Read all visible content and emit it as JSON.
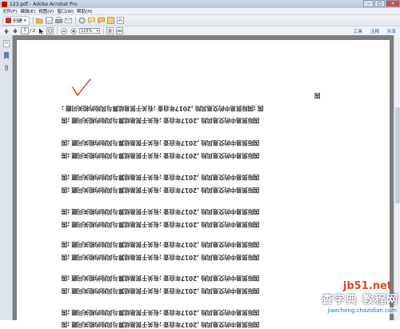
{
  "window": {
    "title": "123.pdf - Adobe Acrobat Pro",
    "controls": [
      "–",
      "□",
      "×"
    ]
  },
  "menubar": [
    "文件(F)",
    "编辑(E)",
    "视图(V)",
    "窗口(W)",
    "帮助(H)"
  ],
  "toolbar": {
    "create_label": "创建",
    "create_caret": "▾",
    "icons": [
      "open-icon",
      "save-icon",
      "print-icon",
      "email-icon",
      "settings-icon",
      "comment-icon",
      "highlight-icon",
      "share-icon",
      "sign-icon"
    ]
  },
  "navbar": {
    "current_page": "1",
    "total_pages": "/ 2",
    "zoom": "115%",
    "caret": "▾",
    "panels": [
      "工具",
      "注释",
      "共享"
    ]
  },
  "document": {
    "lines": [
      "国 ;国际贸易中的交易风险 ,2017年自查 ;有关于贸易结算与风险的相关问题 ;",
      "国际贸易中的交易风险 ,2017年自查 ;有关于贸易结算与风险的相关问题 ;国",
      "国际贸易中的交易风险 ,2017年自查 ;有关于贸易结算与风险的相关问题 ;国",
      "国际贸易中的交易风险 ,2017年自查 ;有关于贸易结算与风险的相关问题 ;国",
      "国际贸易中的交易风险 ,2017年自查 ;有关于贸易结算与风险的相关问题 ;国",
      "国际贸易中的交易风险 ,2017年自查 ;有关于贸易结算与风险的相关问题 ;国",
      "国际贸易中的交易风险 ,2017年自查 ;有关于贸易结算与风险的相关问题 ;国",
      "国际贸易中的交易风险 ,2017年自查 ;有关于贸易结算与风险的相关问题 ;国",
      "国际贸易中的交易风险 ,2017年自查 ;有关于贸易结算与风险的相关问题 ;国",
      "国际贸易中的交易风险 ,2017年自查 ;有关于贸易结算与风险的相关问题 ;国",
      "国际贸易中的交易风险 ,2017年自查 ;有关于贸易结算与风险的相关问题 ;国",
      "国际贸易中的交易风险 ,2017年自查 ;有关于贸易结算与风险的相关问题 ;国",
      "国际贸易中的交易风险 ,2017年自查 ;有关于贸易结算与风险的相关问题 ;国",
      "国际贸易中的交易风险 ,2017年自查 ;有关于贸易结算与风险的相关问题 ;国"
    ],
    "paragraph_mark": "国"
  },
  "watermark": {
    "top": "jb51.net",
    "middle": "查字典 教程网",
    "bottom": "jiaocheng.chazidian.com"
  },
  "colors": {
    "annotation_check": "#d9302a",
    "text": "#333333",
    "doc_background": "#7e7e7e"
  }
}
